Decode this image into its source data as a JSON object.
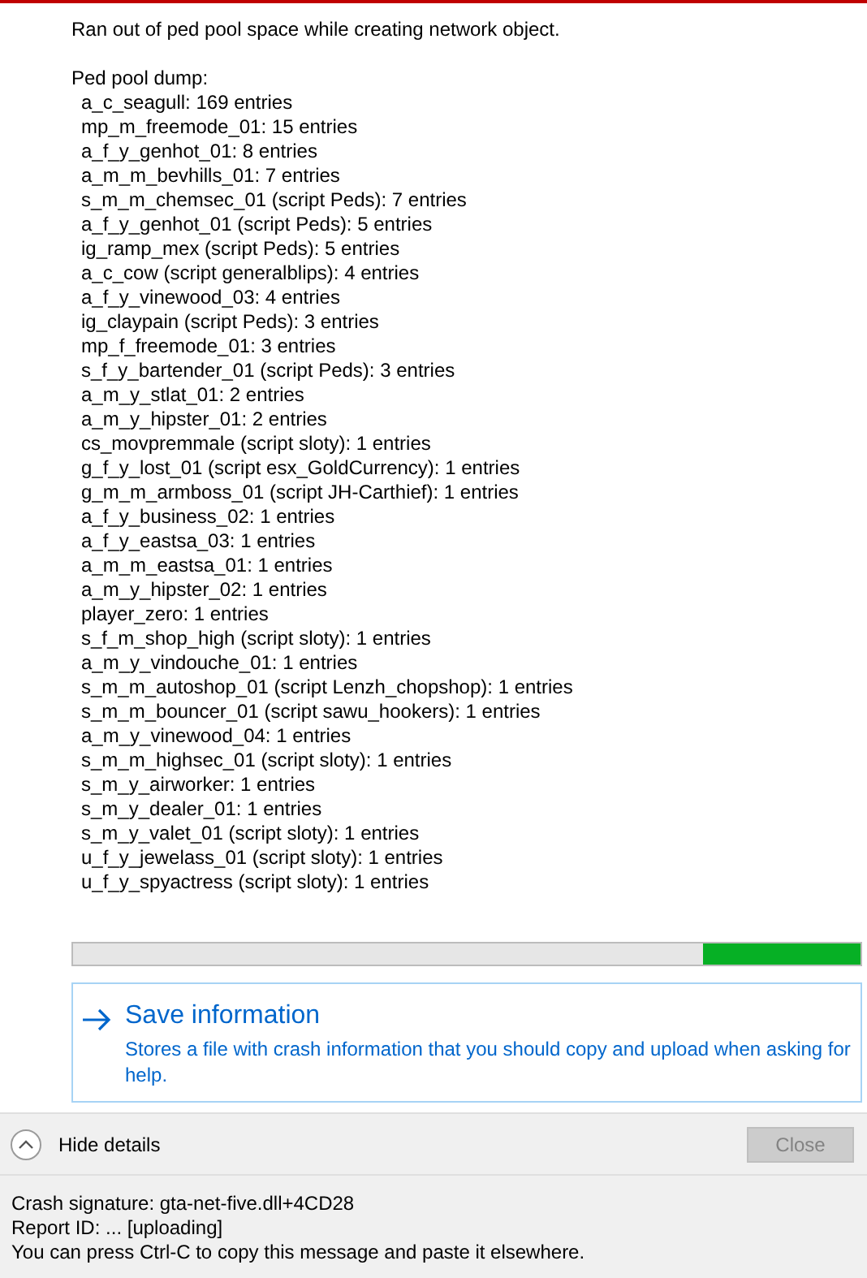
{
  "message": "Ran out of ped pool space while creating network object.",
  "dump_title": "Ped pool dump:",
  "dump_entries": [
    "a_c_seagull: 169 entries",
    "mp_m_freemode_01: 15 entries",
    "a_f_y_genhot_01: 8 entries",
    "a_m_m_bevhills_01: 7 entries",
    "s_m_m_chemsec_01 (script Peds): 7 entries",
    "a_f_y_genhot_01 (script Peds): 5 entries",
    "ig_ramp_mex (script Peds): 5 entries",
    "a_c_cow (script generalblips): 4 entries",
    "a_f_y_vinewood_03: 4 entries",
    "ig_claypain (script Peds): 3 entries",
    "mp_f_freemode_01: 3 entries",
    "s_f_y_bartender_01 (script Peds): 3 entries",
    "a_m_y_stlat_01: 2 entries",
    "a_m_y_hipster_01: 2 entries",
    "cs_movpremmale (script sloty): 1 entries",
    "g_f_y_lost_01 (script esx_GoldCurrency): 1 entries",
    "g_m_m_armboss_01 (script JH-Carthief): 1 entries",
    "a_f_y_business_02: 1 entries",
    "a_f_y_eastsa_03: 1 entries",
    "a_m_m_eastsa_01: 1 entries",
    "a_m_y_hipster_02: 1 entries",
    "player_zero: 1 entries",
    "s_f_m_shop_high (script sloty): 1 entries",
    "a_m_y_vindouche_01: 1 entries",
    "s_m_m_autoshop_01 (script Lenzh_chopshop): 1 entries",
    "s_m_m_bouncer_01 (script sawu_hookers): 1 entries",
    "a_m_y_vinewood_04: 1 entries",
    "s_m_m_highsec_01 (script sloty): 1 entries",
    "s_m_y_airworker: 1 entries",
    "s_m_y_dealer_01: 1 entries",
    "s_m_y_valet_01 (script sloty): 1 entries",
    "u_f_y_jewelass_01 (script sloty): 1 entries",
    "u_f_y_spyactress (script sloty): 1 entries"
  ],
  "progress": {
    "level": 0.2
  },
  "save_link": {
    "title": "Save information",
    "description": "Stores a file with crash information that you should copy and upload when asking for help."
  },
  "details_toggle": {
    "label": "Hide details",
    "expanded": true
  },
  "close_button": {
    "label": "Close",
    "disabled": true
  },
  "footer_lines": [
    "Crash signature: gta-net-five.dll+4CD28",
    "Report ID: ... [uploading]",
    "You can press Ctrl-C to copy this message and paste it elsewhere."
  ]
}
